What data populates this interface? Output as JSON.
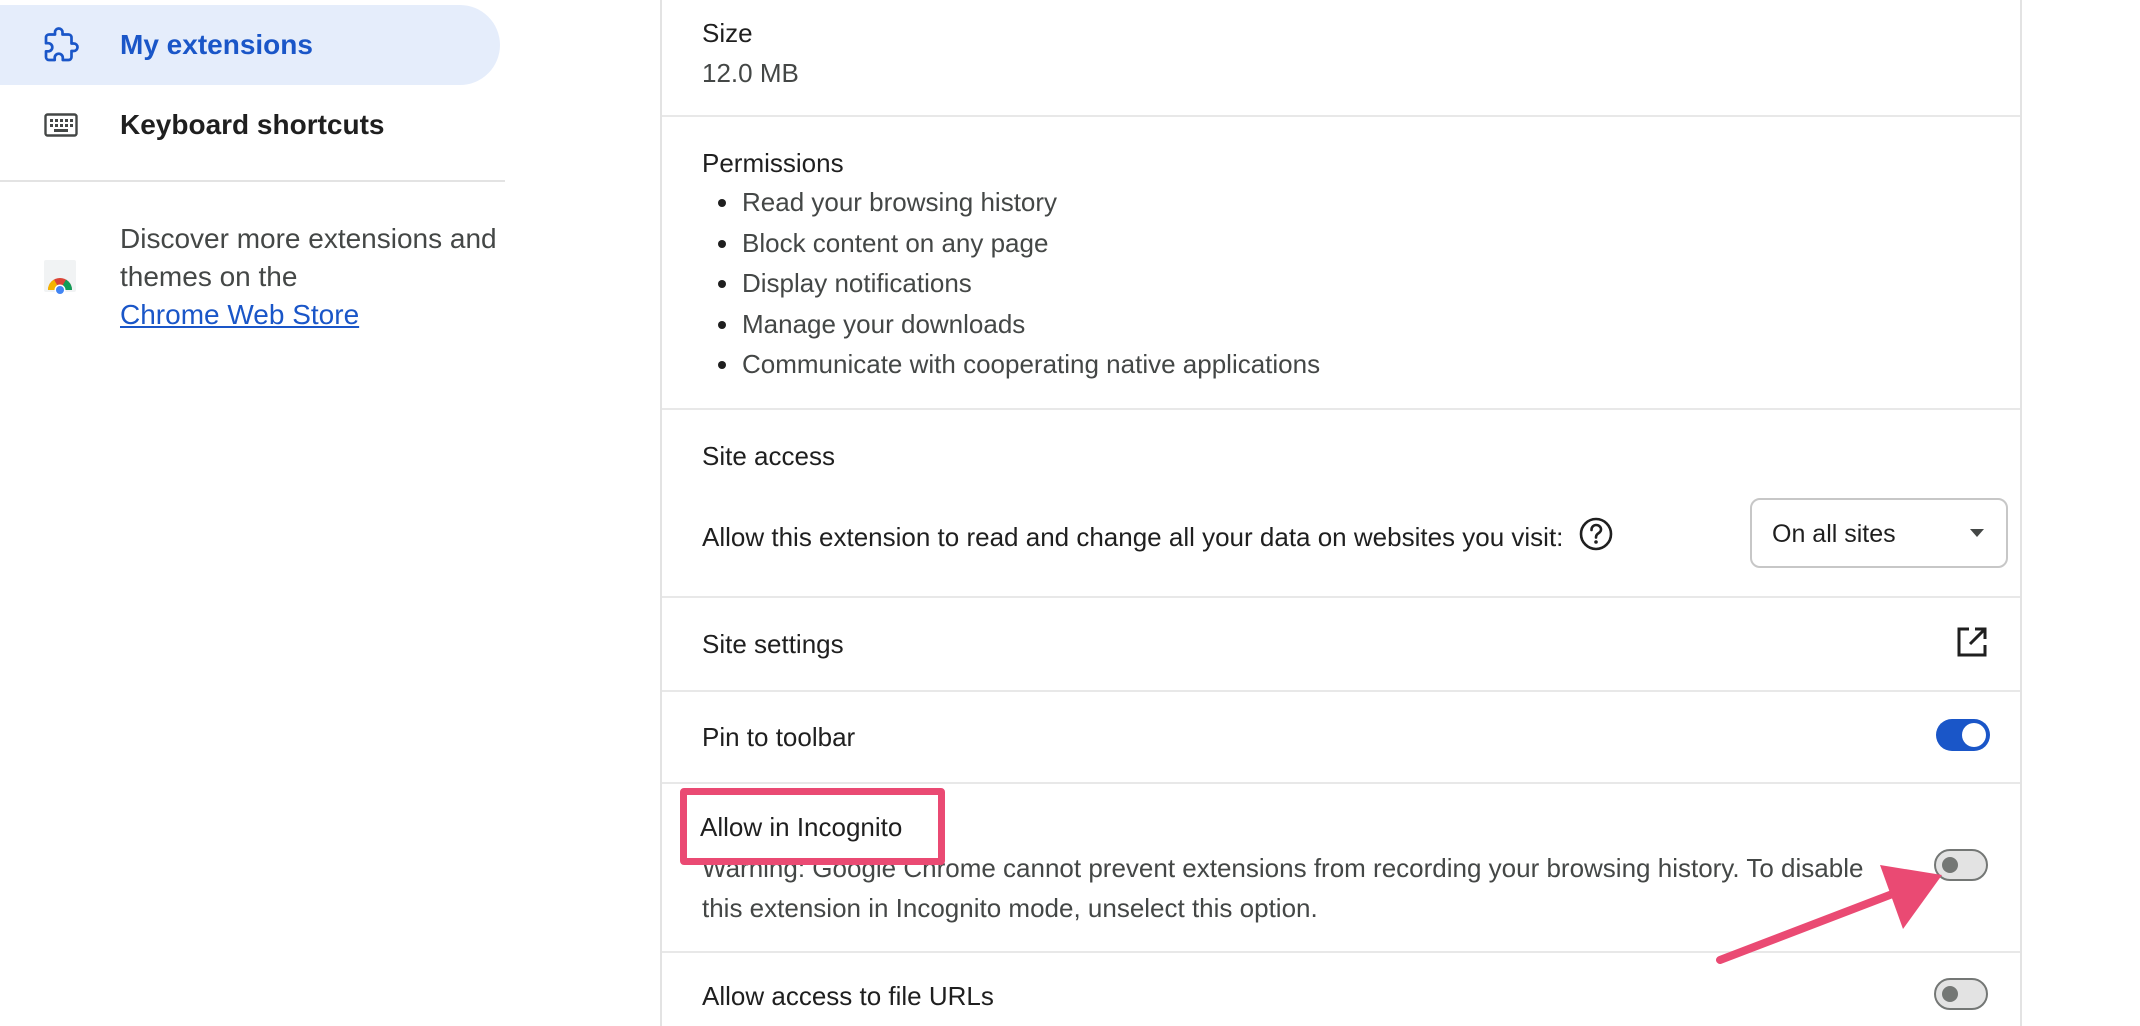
{
  "sidebar": {
    "items": [
      {
        "label": "My extensions",
        "icon": "extension-puzzle-icon",
        "active": true
      },
      {
        "label": "Keyboard shortcuts",
        "icon": "keyboard-icon",
        "active": false
      }
    ],
    "discover": {
      "text": "Discover more extensions and themes on the",
      "link": "Chrome Web Store",
      "icon": "chrome-web-store-icon"
    }
  },
  "details": {
    "size": {
      "title": "Size",
      "value": "12.0 MB"
    },
    "permissions": {
      "title": "Permissions",
      "items": [
        "Read your browsing history",
        "Block content on any page",
        "Display notifications",
        "Manage your downloads",
        "Communicate with cooperating native applications"
      ]
    },
    "site_access": {
      "title": "Site access",
      "description": "Allow this extension to read and change all your data on websites you visit:",
      "selected": "On all sites"
    },
    "site_settings": {
      "label": "Site settings"
    },
    "pin_to_toolbar": {
      "label": "Pin to toolbar",
      "enabled": true
    },
    "incognito": {
      "label": "Allow in Incognito",
      "warning": "Warning: Google Chrome cannot prevent extensions from recording your browsing history. To disable this extension in Incognito mode, unselect this option.",
      "enabled": false
    },
    "file_urls": {
      "label": "Allow access to file URLs",
      "enabled": false
    }
  },
  "colors": {
    "accent": "#1a56c8",
    "active_nav_bg": "#e5edfb",
    "annotation": "#ea4a73"
  }
}
